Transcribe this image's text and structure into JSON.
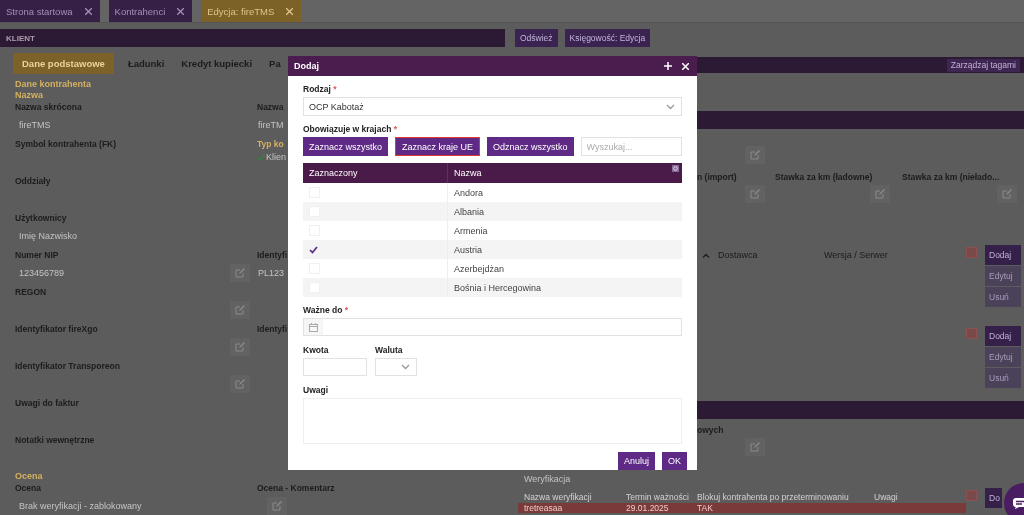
{
  "tabs": [
    {
      "label": "Strona startowa",
      "selected": false
    },
    {
      "label": "Kontrahenci",
      "selected": false
    },
    {
      "label": "Edycja: fireTMS",
      "selected": true
    }
  ],
  "client_panel": {
    "title": "KLIENT",
    "tabs": [
      {
        "label": "Dane podstawowe",
        "selected": true
      },
      {
        "label": "Ładunki",
        "selected": false
      },
      {
        "label": "Kredyt kupiecki",
        "selected": false
      },
      {
        "label": "Pa",
        "selected": false
      }
    ],
    "rows": [
      {
        "kind": "heading",
        "text": "Dane kontrahenta"
      },
      {
        "kind": "heading",
        "text": "Nazwa"
      },
      {
        "kind": "fields",
        "cells": [
          {
            "kind": "field",
            "label": "Nazwa skrócona",
            "value": "fireTMS"
          },
          {
            "kind": "field",
            "label": "Nazwa",
            "value": "fireTM"
          }
        ]
      },
      {
        "kind": "fields",
        "cells": [
          {
            "kind": "field",
            "label": "Symbol kontrahenta (FK)"
          },
          {
            "kind": "checks",
            "label": "Typ ko",
            "items": [
              "Klien"
            ]
          }
        ]
      },
      {
        "kind": "fields",
        "cells": [
          {
            "kind": "field",
            "label": "Oddziały"
          }
        ]
      },
      {
        "kind": "fields",
        "cells": [
          {
            "kind": "field",
            "label": "Użytkownicy",
            "value": "Imię Nazwisko"
          }
        ]
      },
      {
        "kind": "fields",
        "cells": [
          {
            "kind": "field",
            "label": "Numer NIP",
            "value": "123456789",
            "editable": true
          },
          {
            "kind": "field",
            "label": "Identyfi",
            "value": "PL123"
          }
        ]
      },
      {
        "kind": "fields",
        "cells": [
          {
            "kind": "field",
            "label": "REGON",
            "editable": true
          }
        ]
      },
      {
        "kind": "fields",
        "cells": [
          {
            "kind": "field",
            "label": "Identyfikator fireXgo",
            "editable": true
          },
          {
            "kind": "field",
            "label": "Identyfi"
          }
        ]
      },
      {
        "kind": "fields",
        "cells": [
          {
            "kind": "field",
            "label": "Identyfikator Transporeon",
            "editable": true
          }
        ]
      },
      {
        "kind": "fields",
        "cells": [
          {
            "kind": "field",
            "label": "Uwagi do faktur"
          }
        ]
      },
      {
        "kind": "fields",
        "cells": [
          {
            "kind": "field",
            "label": "Notatki wewnętrzne"
          }
        ]
      },
      {
        "kind": "heading",
        "text": "Ocena"
      },
      {
        "kind": "fields",
        "cells": [
          {
            "kind": "field",
            "label": "Ocena",
            "value": "Brak weryfikacji - zablokowany"
          },
          {
            "kind": "field",
            "label": "Ocena - Komentarz",
            "editable": true
          }
        ]
      }
    ]
  },
  "right_panel": {
    "buttons": [
      {
        "label": "Odśwież"
      },
      {
        "label": "Księgowość: Edycja"
      }
    ],
    "tags_button": "Zarządzaj tagami",
    "upper_field": {
      "editable": true
    },
    "rate_fields": [
      {
        "label": "n (import)",
        "editable": true
      },
      {
        "label": "Stawka za km (ładowne)",
        "editable": true
      },
      {
        "label": "Stawka za km (niełado...",
        "editable": true
      }
    ],
    "groups": [
      {
        "columns": [
          {
            "label": "Dostawca",
            "sorted": true
          },
          {
            "label": "Wersja / Serwer",
            "sorted": false
          }
        ],
        "actions": [
          {
            "label": "Dodaj",
            "disabled": false
          },
          {
            "label": "Edytuj",
            "disabled": true
          },
          {
            "label": "Usuń",
            "disabled": true
          }
        ]
      },
      {
        "actions": [
          {
            "label": "Dodaj",
            "disabled": false
          },
          {
            "label": "Edytuj",
            "disabled": true
          },
          {
            "label": "Usuń",
            "disabled": true
          }
        ]
      }
    ],
    "lower_field": {
      "label": "owych",
      "editable": true
    },
    "verification": {
      "title": "Weryfikacja",
      "columns": [
        "Nazwa weryfikacji",
        "Termin ważności",
        "Blokuj kontrahenta po przeterminowaniu",
        "Uwagi"
      ],
      "rows": [
        {
          "cells": [
            "tretreasaa",
            "29.01.2025",
            "TAK"
          ],
          "expired": true
        }
      ],
      "actions": [
        {
          "label": "Do",
          "disabled": false
        }
      ]
    }
  },
  "dialog": {
    "title": "Dodaj",
    "type": {
      "label": "Rodzaj",
      "required_mark": "*",
      "value": "OCP Kabotaż"
    },
    "countries": {
      "label": "Obowiązuje w krajach",
      "required_mark": "*",
      "buttons": [
        {
          "label": "Zaznacz wszystko",
          "focused": false
        },
        {
          "label": "Zaznacz kraje UE",
          "focused": true
        },
        {
          "label": "Odznacz wszystko",
          "focused": false
        }
      ],
      "search_placeholder": "Wyszukaj...",
      "columns": [
        "Zaznaczony",
        "Nazwa"
      ],
      "rows": [
        {
          "name": "Andora",
          "checked": false
        },
        {
          "name": "Albania",
          "checked": false
        },
        {
          "name": "Armenia",
          "checked": false
        },
        {
          "name": "Austria",
          "checked": true
        },
        {
          "name": "Azerbejdżan",
          "checked": false
        },
        {
          "name": "Bośnia i Hercegowina",
          "checked": false
        }
      ]
    },
    "valid_until": {
      "label": "Ważne do",
      "required_mark": "*"
    },
    "amount": {
      "label": "Kwota"
    },
    "currency": {
      "label": "Waluta"
    },
    "notes": {
      "label": "Uwagi"
    },
    "buttons": [
      {
        "label": "Anuluj"
      },
      {
        "label": "OK"
      }
    ]
  }
}
